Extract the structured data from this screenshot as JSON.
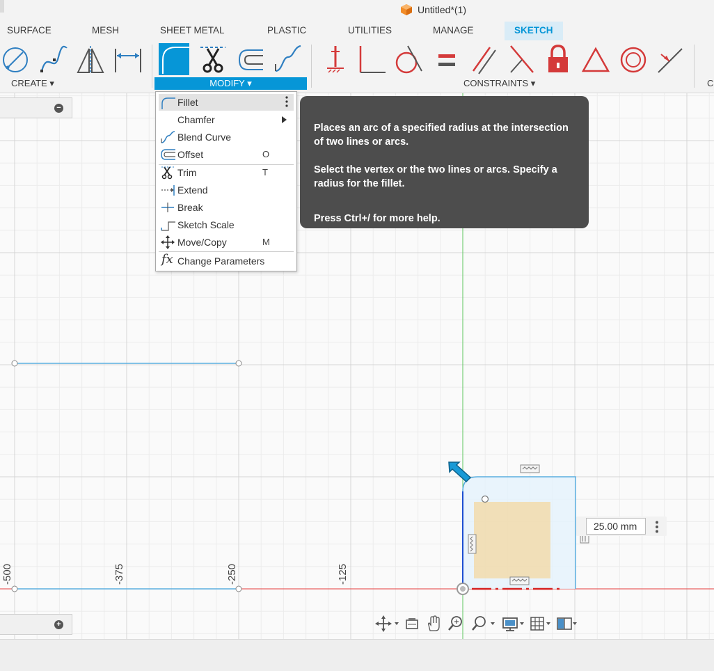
{
  "window": {
    "title": "Untitled*(1)"
  },
  "tabs": [
    {
      "label": "SURFACE",
      "active": false
    },
    {
      "label": "MESH",
      "active": false
    },
    {
      "label": "SHEET METAL",
      "active": false
    },
    {
      "label": "PLASTIC",
      "active": false
    },
    {
      "label": "UTILITIES",
      "active": false
    },
    {
      "label": "MANAGE",
      "active": false
    },
    {
      "label": "SKETCH",
      "active": true
    }
  ],
  "toolbar": {
    "groups": {
      "create": "CREATE",
      "modify": "MODIFY",
      "constraints": "CONSTRAINTS",
      "cut": "C"
    },
    "tools": {
      "create": [
        "circle-icon",
        "spline-icon",
        "mirror-icon",
        "dimension-icon"
      ],
      "modify": [
        "fillet-icon",
        "trim-icon",
        "offset-icon",
        "blend-curve-icon"
      ],
      "constraints": [
        "fix-icon",
        "perpendicular-icon",
        "tangent-icon",
        "equal-icon",
        "parallel-icon",
        "collinear-icon",
        "lock-icon",
        "triangle-icon",
        "concentric-icon",
        "midpoint-icon"
      ]
    }
  },
  "modify_menu": {
    "items": [
      {
        "label": "Fillet",
        "key": "",
        "icon": "fillet-icon",
        "highlighted": true,
        "has_more": true
      },
      {
        "label": "Chamfer",
        "key": "",
        "icon": "",
        "submenu": true
      },
      {
        "label": "Blend Curve",
        "key": "",
        "icon": "blend-curve-icon"
      },
      {
        "label": "Offset",
        "key": "O",
        "icon": "offset-icon"
      },
      {
        "label": "Trim",
        "key": "T",
        "icon": "trim-icon"
      },
      {
        "label": "Extend",
        "key": "",
        "icon": "extend-icon"
      },
      {
        "label": "Break",
        "key": "",
        "icon": "break-icon"
      },
      {
        "label": "Sketch Scale",
        "key": "",
        "icon": "sketch-scale-icon"
      },
      {
        "label": "Move/Copy",
        "key": "M",
        "icon": "move-copy-icon"
      },
      {
        "label": "Change Parameters",
        "key": "",
        "icon": "fx-icon"
      }
    ]
  },
  "tooltip": {
    "line1": "Places an arc of a specified radius at the intersection of two lines or arcs.",
    "line2": "Select the vertex or the two lines or arcs. Specify a radius for the fillet.",
    "line3": "Press Ctrl+/ for more help."
  },
  "canvas": {
    "axis_labels": [
      "-500",
      "-375",
      "-250",
      "-125"
    ],
    "dimension_value": "25.00 mm"
  },
  "navbar": {
    "tools": [
      "orbit-icon",
      "look-at-icon",
      "pan-icon",
      "zoom-icon",
      "zoom-window-icon",
      "display-settings-icon",
      "grid-icon",
      "viewports-icon"
    ]
  },
  "colors": {
    "accent": "#0696d7",
    "x_axis": "#e63c3c",
    "y_axis": "#5fc75f",
    "sketch_line": "#5aaee0",
    "profile_fill": "#f2d9a6"
  }
}
